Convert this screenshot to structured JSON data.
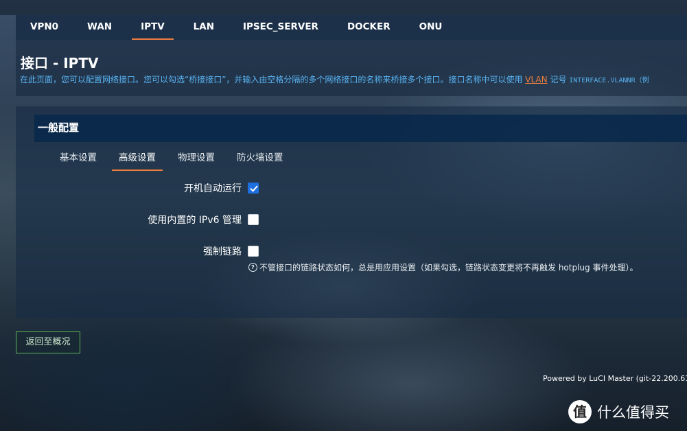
{
  "navbar": {
    "tabs": [
      {
        "label": "VPN0"
      },
      {
        "label": "WAN"
      },
      {
        "label": "IPTV"
      },
      {
        "label": "LAN"
      },
      {
        "label": "IPSEC_SERVER"
      },
      {
        "label": "DOCKER"
      },
      {
        "label": "ONU"
      }
    ],
    "active_index": 2
  },
  "page": {
    "title": "接口 - IPTV",
    "description_pre": "在此页面，您可以配置网络接口。您可以勾选“桥接接口”，并输入由空格分隔的多个网络接口的名称来桥接多个接口。接口名称中可以使用 ",
    "description_link": "VLAN",
    "description_mid": " 记号 ",
    "description_code": "INTERFACE.VLANNR（例"
  },
  "section": {
    "title": "一般配置",
    "subtabs": [
      {
        "label": "基本设置"
      },
      {
        "label": "高级设置"
      },
      {
        "label": "物理设置"
      },
      {
        "label": "防火墙设置"
      }
    ],
    "active_subtab": 1
  },
  "options": [
    {
      "label": "开机自动运行",
      "checked": true
    },
    {
      "label": "使用内置的 IPv6 管理",
      "checked": false
    },
    {
      "label": "强制链路",
      "checked": false
    }
  ],
  "help": {
    "icon": "?",
    "text": "不管接口的链路状态如何，总是用应用设置（如果勾选，链路状态变更将不再触发 hotplug 事件处理）。"
  },
  "back_button": "返回至概况",
  "footer": "Powered by LuCI Master (git-22.200.61",
  "watermark": {
    "icon": "值",
    "text": "什么值得买"
  },
  "colors": {
    "accent": "#ef7e3f",
    "link": "#59b3f2",
    "checkbox": "#1e6fe0",
    "back_border": "#5cb85c"
  }
}
